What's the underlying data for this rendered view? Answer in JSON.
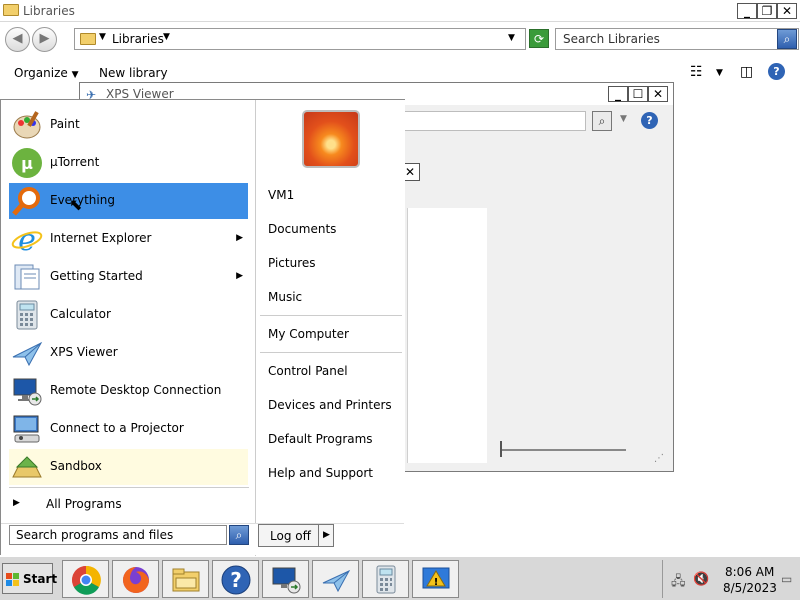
{
  "libraries": {
    "title": "Libraries",
    "address": "Libraries",
    "search_placeholder": "Search Libraries",
    "organize_label": "Organize",
    "new_library_label": "New library"
  },
  "xps_viewer": {
    "title": "XPS Viewer"
  },
  "start_menu": {
    "programs": [
      {
        "label": "Paint",
        "icon": "paint-icon"
      },
      {
        "label": "µTorrent",
        "icon": "utorrent-icon"
      },
      {
        "label": "Everything",
        "icon": "everything-search-icon"
      },
      {
        "label": "Internet Explorer",
        "icon": "internet-explorer-icon"
      },
      {
        "label": "Getting Started",
        "icon": "getting-started-icon"
      },
      {
        "label": "Calculator",
        "icon": "calculator-icon"
      },
      {
        "label": "XPS Viewer",
        "icon": "xps-viewer-icon"
      },
      {
        "label": "Remote Desktop Connection",
        "icon": "remote-desktop-icon"
      },
      {
        "label": "Connect to a Projector",
        "icon": "projector-icon"
      },
      {
        "label": "Sandbox",
        "icon": "sandbox-icon"
      }
    ],
    "all_programs_label": "All Programs",
    "search_placeholder": "Search programs and files",
    "right_links": {
      "vm1": "VM1",
      "documents": "Documents",
      "pictures": "Pictures",
      "music": "Music",
      "my_computer": "My Computer",
      "control_panel": "Control Panel",
      "devices_printers": "Devices and Printers",
      "default_programs": "Default Programs",
      "help_support": "Help and Support"
    },
    "logoff_label": "Log off",
    "selected_accent": "#3d8ee6"
  },
  "taskbar": {
    "start_label": "Start",
    "buttons": [
      "chrome-icon",
      "firefox-icon",
      "file-explorer-icon",
      "help-icon",
      "remote-desktop-icon",
      "xps-viewer-icon",
      "calculator-icon",
      "action-center-icon"
    ],
    "time": "8:06 AM",
    "date": "8/5/2023"
  }
}
